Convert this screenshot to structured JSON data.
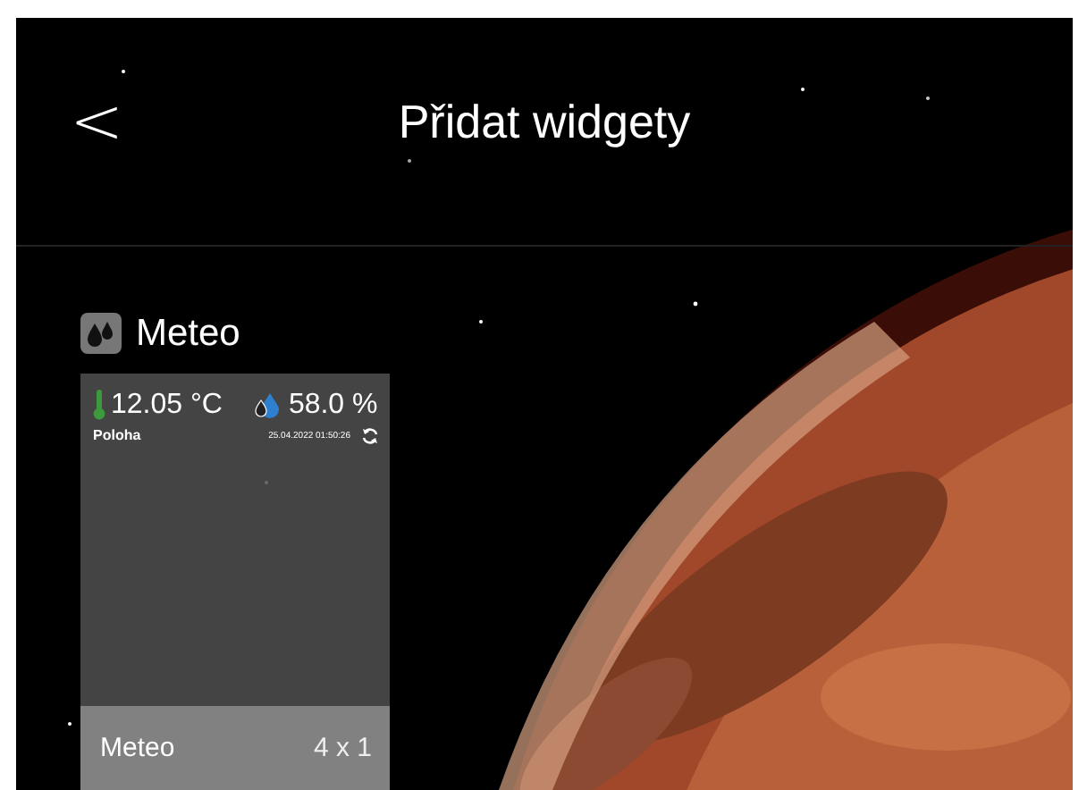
{
  "header": {
    "back": "<",
    "title": "Přidat widgety"
  },
  "app": {
    "name": "Meteo"
  },
  "widget": {
    "temperature": "12.05 °C",
    "humidity": "58.0 %",
    "location": "Poloha",
    "timestamp": "25.04.2022 01:50:26",
    "name": "Meteo",
    "size": "4 x 1"
  }
}
